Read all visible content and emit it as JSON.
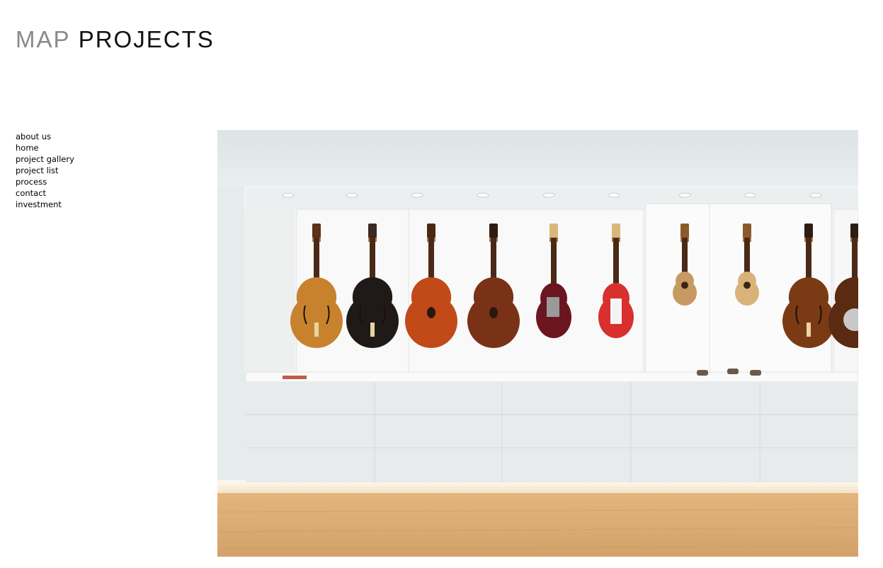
{
  "logo": {
    "part1": "MAP",
    "part2": "PROJECTS"
  },
  "nav": [
    {
      "label": "about us"
    },
    {
      "label": "home"
    },
    {
      "label": "project gallery"
    },
    {
      "label": "project list"
    },
    {
      "label": "process"
    },
    {
      "label": "contact"
    },
    {
      "label": "investment"
    }
  ],
  "photo": {
    "subject": "white wall niche displaying guitars above grey cabinets on oak floor",
    "guitars": [
      {
        "kind": "archtop",
        "color": "#c8822e",
        "head": "#5a3217"
      },
      {
        "kind": "archtop",
        "color": "#1f1a18",
        "head": "#3a2a1f"
      },
      {
        "kind": "acoustic",
        "color": "#c24a18",
        "head": "#4a2814"
      },
      {
        "kind": "acoustic",
        "color": "#7a3216",
        "head": "#2e1d12"
      },
      {
        "kind": "tele",
        "color": "#6a1520",
        "head": "#d9b77a"
      },
      {
        "kind": "strat",
        "color": "#d7302e",
        "head": "#d9b77a"
      },
      {
        "kind": "mandolin",
        "color": "#c69a62",
        "head": "#8a5a2a"
      },
      {
        "kind": "mandolin",
        "color": "#d9b27a",
        "head": "#8a5a2a"
      },
      {
        "kind": "semihollow",
        "color": "#7a3a14",
        "head": "#2e1d12"
      },
      {
        "kind": "resonator",
        "color": "#5a2a12",
        "head": "#2e1d12"
      }
    ]
  }
}
